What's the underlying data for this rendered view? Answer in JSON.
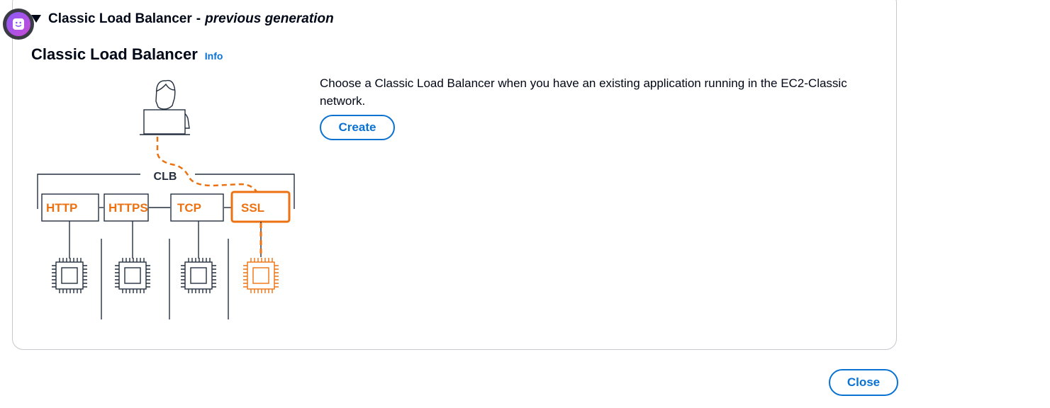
{
  "assistant": {
    "icon": "assistant-face-icon"
  },
  "section": {
    "caret_icon": "caret-down-icon",
    "title": "Classic Load Balancer",
    "separator": "-",
    "subtitle": "previous generation"
  },
  "card": {
    "heading": "Classic Load Balancer",
    "info_label": "Info",
    "description": "Choose a Classic Load Balancer when you have an existing application running in the EC2-Classic network.",
    "create_label": "Create"
  },
  "diagram": {
    "user_icon": "user-laptop-icon",
    "group_label": "CLB",
    "listeners": [
      {
        "label": "HTTP",
        "highlighted": false
      },
      {
        "label": "HTTPS",
        "highlighted": false
      },
      {
        "label": "TCP",
        "highlighted": false
      },
      {
        "label": "SSL",
        "highlighted": true
      }
    ],
    "target_icon": "chip-icon",
    "colors": {
      "accent": "#ec7211",
      "stroke": "#232f3e"
    }
  },
  "footer": {
    "close_label": "Close"
  },
  "colors": {
    "link": "#0972d3",
    "border": "#c6c6cd",
    "text": "#000716"
  }
}
